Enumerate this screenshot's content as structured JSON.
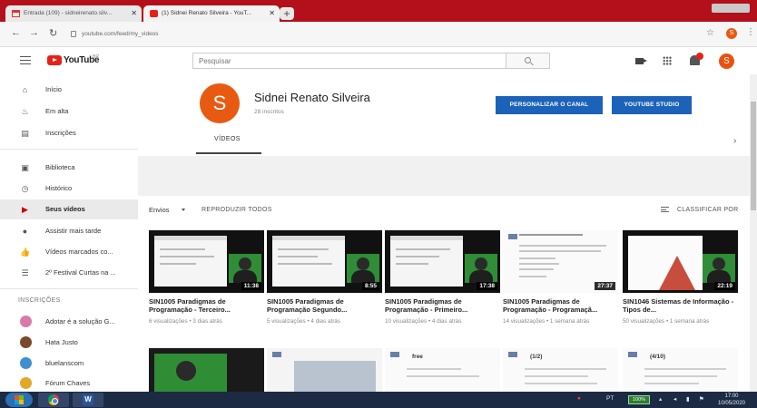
{
  "browser": {
    "tabs": [
      {
        "label": "Entrada (109) - sidneirenato.silv...",
        "icon": "gmail-icon"
      },
      {
        "label": "(1) Sidnei Renato Silveira - YouT...",
        "icon": "youtube-icon"
      }
    ],
    "url": "youtube.com/feed/my_videos",
    "profile_initial": "S"
  },
  "masthead": {
    "logo": "YouTube",
    "logo_country": "BR",
    "search_placeholder": "Pesquisar",
    "avatar_initial": "S"
  },
  "sidebar": {
    "items": [
      {
        "label": "Início",
        "icon": "home-icon"
      },
      {
        "label": "Em alta",
        "icon": "trending-flame-icon"
      },
      {
        "label": "Inscrições",
        "icon": "subscriptions-icon"
      },
      {
        "label": "Biblioteca",
        "icon": "library-icon"
      },
      {
        "label": "Histórico",
        "icon": "history-icon"
      },
      {
        "label": "Seus vídeos",
        "icon": "your-videos-icon",
        "active": true
      },
      {
        "label": "Assistir mais tarde",
        "icon": "watch-later-clock-icon"
      },
      {
        "label": "Vídeos marcados co...",
        "icon": "thumbs-up-icon"
      },
      {
        "label": "2º Festival Curtas na ...",
        "icon": "playlist-icon"
      }
    ],
    "subs_heading": "INSCRIÇÕES",
    "subscriptions": [
      {
        "label": "Adotar é a solução G..."
      },
      {
        "label": "Hata Justo"
      },
      {
        "label": "bluelanscom"
      },
      {
        "label": "Fórum Chaves"
      }
    ]
  },
  "channel": {
    "initial": "S",
    "name": "Sidnei Renato Silveira",
    "subscribers": "28 inscritos",
    "customize_button": "PERSONALIZAR O CANAL",
    "studio_button": "YOUTUBE STUDIO",
    "tab_videos": "VÍDEOS"
  },
  "uploads": {
    "selector": "Envios",
    "play_all": "REPRODUZIR TODOS",
    "sort": "CLASSIFICAR POR"
  },
  "videos": [
    {
      "title": "SIN1005 Paradigmas de Programação - Terceiro...",
      "meta": "6 visualizações • 3 dias atrás",
      "duration": "11:38"
    },
    {
      "title": "SIN1005 Paradigmas de Programação Segundo...",
      "meta": "5 visualizações • 4 dias atrás",
      "duration": "8:55"
    },
    {
      "title": "SIN1005 Paradigmas de Programação - Primeiro...",
      "meta": "10 visualizações • 4 dias atrás",
      "duration": "17:38"
    },
    {
      "title": "SIN1005 Paradigmas de Programação - Programaçã...",
      "meta": "14 visualizações • 1 semana atrás",
      "duration": "27:37"
    },
    {
      "title": "SIN1046 Sistemas de Informação - Tipos de...",
      "meta": "50 visualizações • 1 semana atrás",
      "duration": "22:19"
    }
  ],
  "row2": [
    {
      "text": ""
    },
    {
      "text": ""
    },
    {
      "text": "free"
    },
    {
      "text": "(1/2)"
    },
    {
      "text": "(4/10)"
    }
  ],
  "taskbar": {
    "lang": "PT",
    "battery": "100%",
    "time": "17:00",
    "date": "10/05/2020"
  },
  "colors": {
    "youtube_red": "#e62117",
    "button_blue": "#1c62b9",
    "avatar_orange": "#e85a11"
  }
}
